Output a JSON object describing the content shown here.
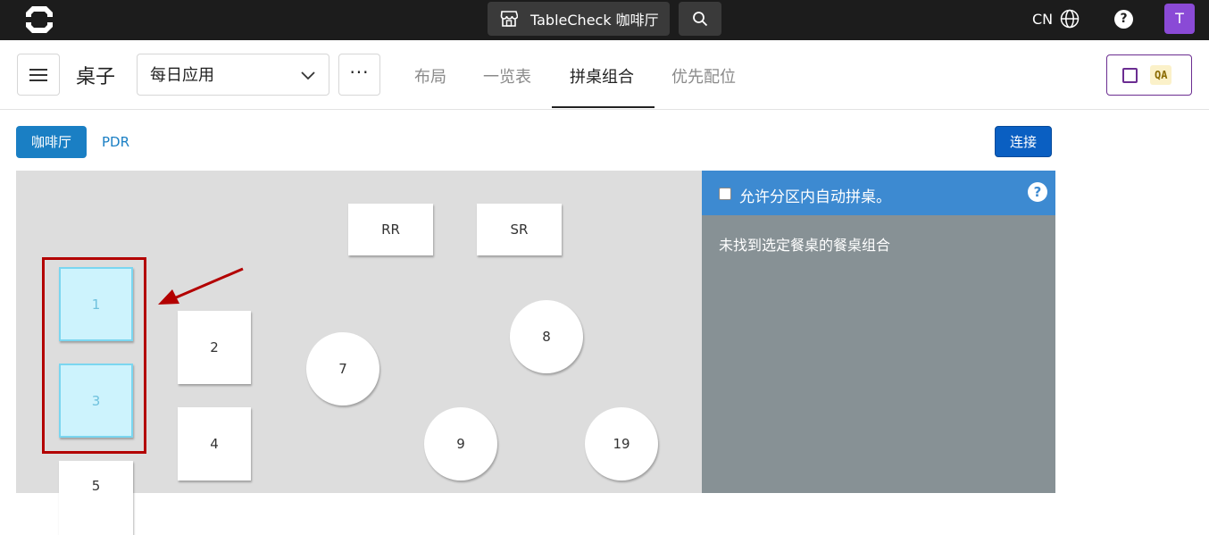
{
  "topbar": {
    "venue_label": "TableCheck 咖啡厅",
    "language": "CN",
    "user_initial": "T"
  },
  "header": {
    "title": "桌子",
    "schedule_select": "每日应用",
    "more_label": "···",
    "tabs": [
      {
        "label": "布局",
        "active": false
      },
      {
        "label": "一览表",
        "active": false
      },
      {
        "label": "拼桌组合",
        "active": true
      },
      {
        "label": "优先配位",
        "active": false
      }
    ],
    "qa_badge": "QA"
  },
  "areas": {
    "tabs": [
      {
        "label": "咖啡厅",
        "active": true
      },
      {
        "label": "PDR",
        "active": false
      }
    ],
    "connect_label": "连接"
  },
  "floor": {
    "tables": [
      {
        "label": "RR",
        "shape": "square",
        "selected": false
      },
      {
        "label": "SR",
        "shape": "square",
        "selected": false
      },
      {
        "label": "1",
        "shape": "square",
        "selected": true
      },
      {
        "label": "3",
        "shape": "square",
        "selected": true
      },
      {
        "label": "2",
        "shape": "square",
        "selected": false
      },
      {
        "label": "4",
        "shape": "square",
        "selected": false
      },
      {
        "label": "5",
        "shape": "square",
        "selected": false
      },
      {
        "label": "7",
        "shape": "round",
        "selected": false
      },
      {
        "label": "8",
        "shape": "round",
        "selected": false
      },
      {
        "label": "9",
        "shape": "round",
        "selected": false
      },
      {
        "label": "19",
        "shape": "round",
        "selected": false
      }
    ]
  },
  "panel": {
    "auto_combine_label": "允许分区内自动拼桌。",
    "empty_message": "未找到选定餐桌的餐桌组合"
  },
  "colors": {
    "topbar_bg": "#1c1c1c",
    "accent_blue": "#1a7fc4",
    "panel_header": "#3d8ad1",
    "panel_bg": "#879195",
    "selected_table": "#cdf3fd",
    "highlight_red": "#b30000",
    "avatar_purple": "#8a4ad6"
  }
}
